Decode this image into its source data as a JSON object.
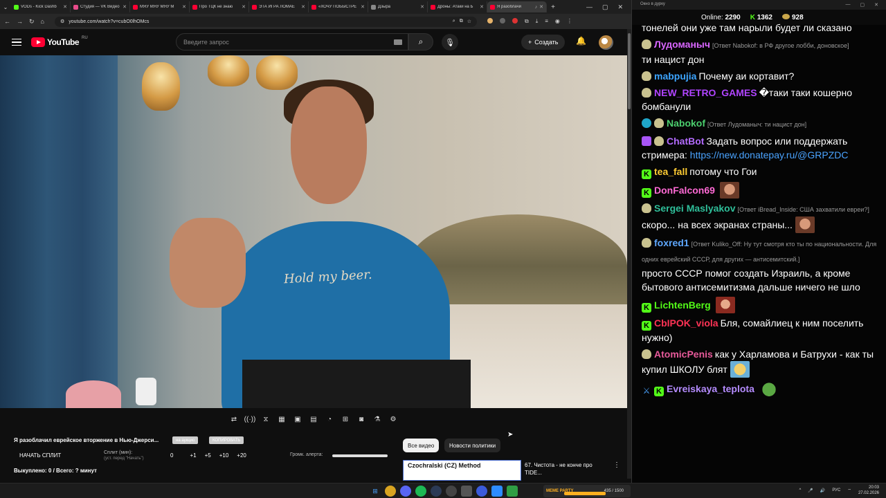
{
  "browser": {
    "tabs": [
      {
        "title": "VODs - Kick Dashb",
        "color": "#53fc18"
      },
      {
        "title": "Студия — VK Видео",
        "color": "#e84b8a"
      },
      {
        "title": "МЯУ МЯУ МЯУ М",
        "color": "#ff0033"
      },
      {
        "title": "Про ТЦК не знаю",
        "color": "#ff0033"
      },
      {
        "title": "ЭТА ИГРА ЛОМАЕ",
        "color": "#ff0033"
      },
      {
        "title": "«ХОЧУ ПОБЫСТРЕ",
        "color": "#ff0033"
      },
      {
        "title": "Дзыра",
        "color": "#888888"
      },
      {
        "title": "Дроны: Атаки на Б",
        "color": "#ff0033"
      },
      {
        "title": "Я разоблачи",
        "color": "#ff0033"
      }
    ],
    "url": "youtube.com/watch?v=cubO0lhOMcs"
  },
  "youtube": {
    "logo_text": "YouTube",
    "region": "RU",
    "search_placeholder": "Введите запрос",
    "create_label": "Создать"
  },
  "video": {
    "shirt_text": "Hold my beer."
  },
  "below_video": {
    "title": "Я разоблачил еврейское вторжение в Нью-Джерси...",
    "pill_1": "на аукцио",
    "pill_2": "КОПИРОВАТЬ",
    "start_split": "НАЧАТЬ СПЛИТ",
    "split_label": "Сплит (мин):",
    "split_hint": "(уст. перед \"Начать\")",
    "split_values": [
      "0",
      "+1",
      "+5",
      "+10",
      "+20"
    ],
    "alert_volume_label": "Громк. алерта:",
    "bought": "Выкуплено: 0 / Всего: ? минут",
    "chips": [
      "Все видео",
      "Новости политики"
    ],
    "rec_thumb_text": "Czochralski (CZ) Method",
    "rec_title": "67. Чистота - не конче про TIDE..."
  },
  "chat": {
    "window_title": "Окно в дурку",
    "online_label": "Online:",
    "online": "2290",
    "kick_count": "1362",
    "coins": "928",
    "messages": [
      {
        "user": "",
        "color": "#ffffff",
        "reply": "",
        "text": "тонелей они уже там нарыли будет ли сказано"
      },
      {
        "user": "Лудоманыч",
        "color": "#d966ff",
        "reply": "[Ответ Nabokof: в РФ другое лобби, доновское]",
        "text": "ти нацист дон"
      },
      {
        "user": "mabpujia",
        "color": "#3da5ff",
        "reply": "",
        "text": "Почему аи кортавит?"
      },
      {
        "user": "NEW_RETRO_GAMES",
        "color": "#b044ff",
        "reply": "",
        "text": "�таки таки кошерно бомбанули"
      },
      {
        "user": "Nabokof",
        "color": "#4ccf6e",
        "reply": "[Ответ Лудоманыч: ти нацист дон]",
        "text": ""
      },
      {
        "user": "ChatBot",
        "color": "#b36bff",
        "reply": "",
        "text": "Задать вопрос или поддержать стримера: ",
        "link": "https://new.donatepay.ru/@GRPZDC"
      },
      {
        "user": "tea_fall",
        "color": "#ffcc33",
        "reply": "",
        "text": "потому что Гои"
      },
      {
        "user": "DonFalcon69",
        "color": "#ff6ad5",
        "reply": "",
        "text": ""
      },
      {
        "user": "Sergei Maslyakov",
        "color": "#2fbf9a",
        "reply": "[Ответ iBread_Inside: США захватили евреи?]",
        "text": "скоро... на всех экранах страны..."
      },
      {
        "user": "foxred1",
        "color": "#5ea8ff",
        "reply": "[Ответ Kuliko_Off: Ну тут смотря кто ты по национальности. Для одних еврейский СССР, для других — антисемитский.]",
        "text": "просто СССР помог создать Израиль, а кроме бытового антисемитизма дальше ничего не шло"
      },
      {
        "user": "LichtenBerg",
        "color": "#53fc18",
        "reply": "",
        "text": ""
      },
      {
        "user": "CbIPOK_viola",
        "color": "#ff3355",
        "reply": "",
        "text": "Бля, сомайлиец к ним поселить нужно)"
      },
      {
        "user": "AtomicPenis",
        "color": "#e85a9a",
        "reply": "",
        "text": "как у Харламова и Батрухи - как ты купил ШКОЛУ блят"
      },
      {
        "user": "Evreiskaya_teplota",
        "color": "#b58cff",
        "reply": "",
        "text": ""
      }
    ]
  },
  "taskbar": {
    "widget_label": "MEME PARTY",
    "widget_value": "435 / 1500",
    "lang": "РУС",
    "time": "20:03",
    "date": "27.02.2026"
  }
}
